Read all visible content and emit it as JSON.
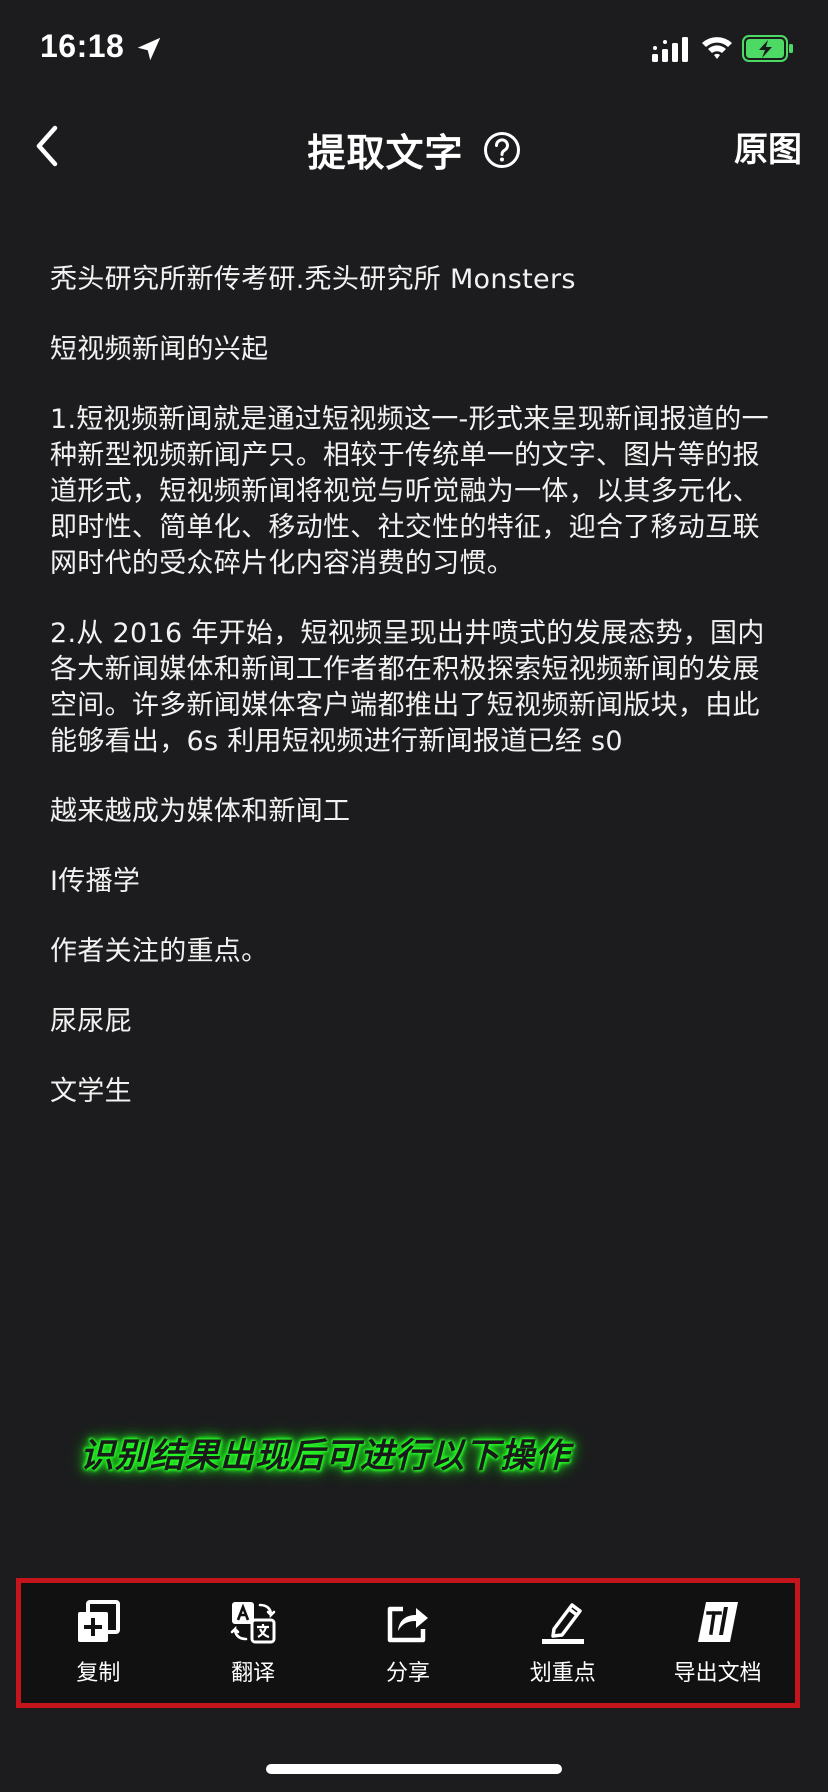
{
  "status_bar": {
    "time": "16:18",
    "icons": [
      "location-arrow-icon",
      "signal-icon",
      "wifi-icon",
      "battery-charging-icon"
    ],
    "battery_color": "#4cd964"
  },
  "nav": {
    "back_icon": "chevron-left-icon",
    "title": "提取文字",
    "help_icon": "question-circle-icon",
    "right_button": "原图"
  },
  "content": {
    "paragraphs": [
      "秃头研究所新传考研.秃头研究所 Monsters",
      "短视频新闻的兴起",
      "1.短视频新闻就是通过短视频这一-形式来呈现新闻报道的一种新型视频新闻产只。相较于传统单一的文字、图片等的报道形式，短视频新闻将视觉与听觉融为一体，以其多元化、即时性、简单化、移动性、社交性的特征，迎合了移动互联网时代的受众碎片化内容消费的习惯。",
      "2.从 2016 年开始，短视频呈现出井喷式的发展态势，国内各大新闻媒体和新闻工作者都在积极探索短视频新闻的发展空间。许多新闻媒体客户端都推出了短视频新闻版块，由此能够看出，6s 利用短视频进行新闻报道已经 s0",
      "越来越成为媒体和新闻工",
      "I传播学",
      "作者关注的重点。",
      "尿尿屁",
      "文学生"
    ]
  },
  "hint": {
    "text": "识别结果出现后可进行以下操作",
    "glow_color": "#29ff29"
  },
  "toolbar": {
    "border_color": "#c4151c",
    "items": [
      {
        "label": "复制",
        "icon": "copy-icon"
      },
      {
        "label": "翻译",
        "icon": "translate-icon"
      },
      {
        "label": "分享",
        "icon": "share-icon"
      },
      {
        "label": "划重点",
        "icon": "highlight-icon"
      },
      {
        "label": "导出文档",
        "icon": "export-document-icon"
      }
    ]
  }
}
